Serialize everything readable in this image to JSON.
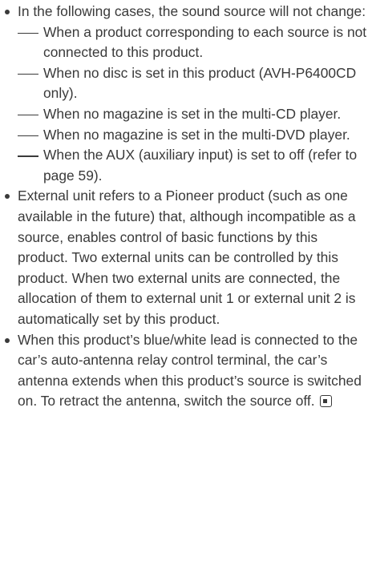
{
  "bullets": [
    {
      "text": "In the following cases, the sound source will not change:",
      "subitems": [
        "When a product corresponding to each source is not connected to this product.",
        "When no disc is set in this product (AVH-P6400CD only).",
        "When no magazine is set in the multi-CD player.",
        "When no magazine is set in the multi-DVD player.",
        "When the AUX (auxiliary input) is set to off (refer to page 59)."
      ]
    },
    {
      "text": "External unit refers to a Pioneer product (such as one available in the future) that, although incompatible as a source, enables control of basic functions by this product. Two external units can be controlled by this product. When two external units are connected, the allocation of them to external unit 1 or external unit 2 is automatically set by this product."
    },
    {
      "text": "When this product’s blue/white lead is connected to the car’s auto-antenna relay control terminal, the car’s antenna extends when this product’s source is switched on. To retract the antenna, switch the source off."
    }
  ],
  "end_marker_icon": "end-of-section-icon"
}
